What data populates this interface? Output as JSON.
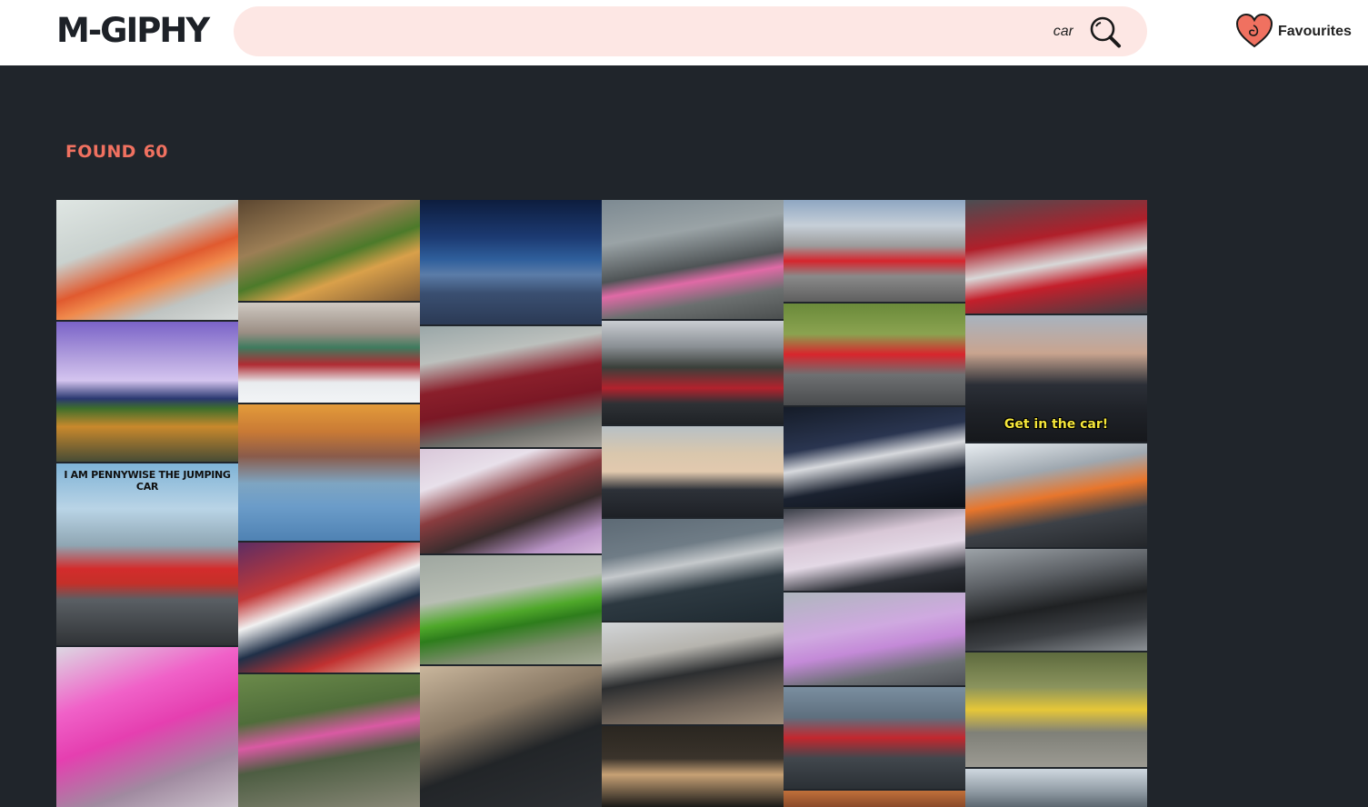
{
  "app": {
    "logo": "M-GIPHY"
  },
  "search": {
    "value": "car",
    "placeholder": ""
  },
  "favourites": {
    "label": "Favourites",
    "icon": "heart-icon",
    "color": "#f07160"
  },
  "results": {
    "found_label": "FOUND",
    "count": "60"
  },
  "gifs": [
    {
      "caption": ""
    },
    {
      "caption": ""
    },
    {
      "caption": "I AM PENNYWISE THE JUMPING CAR"
    },
    {
      "caption": ""
    },
    {
      "caption": ""
    },
    {
      "caption": ""
    },
    {
      "caption": ""
    },
    {
      "caption": ""
    },
    {
      "caption": ""
    },
    {
      "caption": ""
    },
    {
      "caption": ""
    },
    {
      "caption": ""
    },
    {
      "caption": ""
    },
    {
      "caption": ""
    },
    {
      "caption": ""
    },
    {
      "caption": ""
    },
    {
      "caption": ""
    },
    {
      "caption": ""
    },
    {
      "caption": ""
    },
    {
      "caption": ""
    },
    {
      "caption": ""
    },
    {
      "caption": ""
    },
    {
      "caption": ""
    },
    {
      "caption": ""
    },
    {
      "caption": ""
    },
    {
      "caption": ""
    },
    {
      "caption": ""
    },
    {
      "caption": ""
    },
    {
      "caption": "Get in the car!"
    },
    {
      "caption": ""
    },
    {
      "caption": ""
    },
    {
      "caption": ""
    },
    {
      "caption": ""
    }
  ],
  "colors": {
    "background": "#20252b",
    "accent": "#f07160",
    "search_bg": "#fde7e4"
  }
}
